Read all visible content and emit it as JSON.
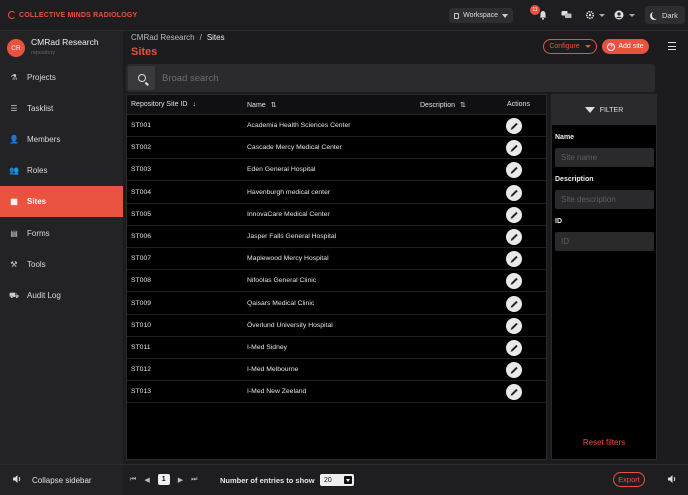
{
  "topbar": {
    "logo_text": "COLLECTIVE MINDS RADIOLOGY",
    "workspace_label": "Workspace",
    "notification_count": "11",
    "theme_label": "Dark"
  },
  "sidebar": {
    "org_initials": "CR",
    "org_name": "CMRad Research",
    "org_subtitle": "repository",
    "items": [
      {
        "label": "Projects",
        "icon": "flask-icon"
      },
      {
        "label": "Tasklist",
        "icon": "list-icon"
      },
      {
        "label": "Members",
        "icon": "person-icon"
      },
      {
        "label": "Roles",
        "icon": "people-icon"
      },
      {
        "label": "Sites",
        "icon": "building-icon"
      },
      {
        "label": "Forms",
        "icon": "form-icon"
      },
      {
        "label": "Tools",
        "icon": "tools-icon"
      },
      {
        "label": "Audit Log",
        "icon": "truck-icon"
      }
    ],
    "active": "Sites",
    "collapse_label": "Collapse sidebar"
  },
  "header": {
    "breadcrumb_parent": "CMRad Research",
    "breadcrumb_sep": "/",
    "breadcrumb_current": "Sites",
    "title": "Sites",
    "configure_label": "Configure",
    "add_label": "Add site"
  },
  "search": {
    "placeholder": "Broad search"
  },
  "table": {
    "columns": {
      "id": "Repository Site ID",
      "name": "Name",
      "description": "Description",
      "actions": "Actions"
    },
    "rows": [
      {
        "id": "ST001",
        "name": "Academia Health Sciences Center"
      },
      {
        "id": "ST002",
        "name": "Cascade Mercy Medical Center"
      },
      {
        "id": "ST003",
        "name": "Eden General Hospital"
      },
      {
        "id": "ST004",
        "name": "Havenburgh medical center"
      },
      {
        "id": "ST005",
        "name": "InnovaCare Medical Center"
      },
      {
        "id": "ST006",
        "name": "Jasper Falls General Hospital"
      },
      {
        "id": "ST007",
        "name": "Maplewood Mercy Hospital"
      },
      {
        "id": "ST008",
        "name": "Nifoolas General Clinic"
      },
      {
        "id": "ST009",
        "name": "Qaisars Medical Clinic"
      },
      {
        "id": "ST010",
        "name": "Överlund University Hospital"
      },
      {
        "id": "ST011",
        "name": "I-Med Sidney"
      },
      {
        "id": "ST012",
        "name": "I-Med Melbourne"
      },
      {
        "id": "ST013",
        "name": "I-Med New Zeeland"
      }
    ]
  },
  "filter": {
    "title": "FILTER",
    "name_label": "Name",
    "name_placeholder": "Site name",
    "description_label": "Description",
    "description_placeholder": "Site description",
    "id_label": "ID",
    "id_placeholder": "ID",
    "reset_label": "Reset filters"
  },
  "footer": {
    "current_page": "1",
    "entries_label": "Number of entries to show",
    "entries_value": "20",
    "export_label": "Export"
  },
  "colors": {
    "accent": "#e8523f",
    "background": "#1c1c1e",
    "table_bg": "#000000"
  }
}
